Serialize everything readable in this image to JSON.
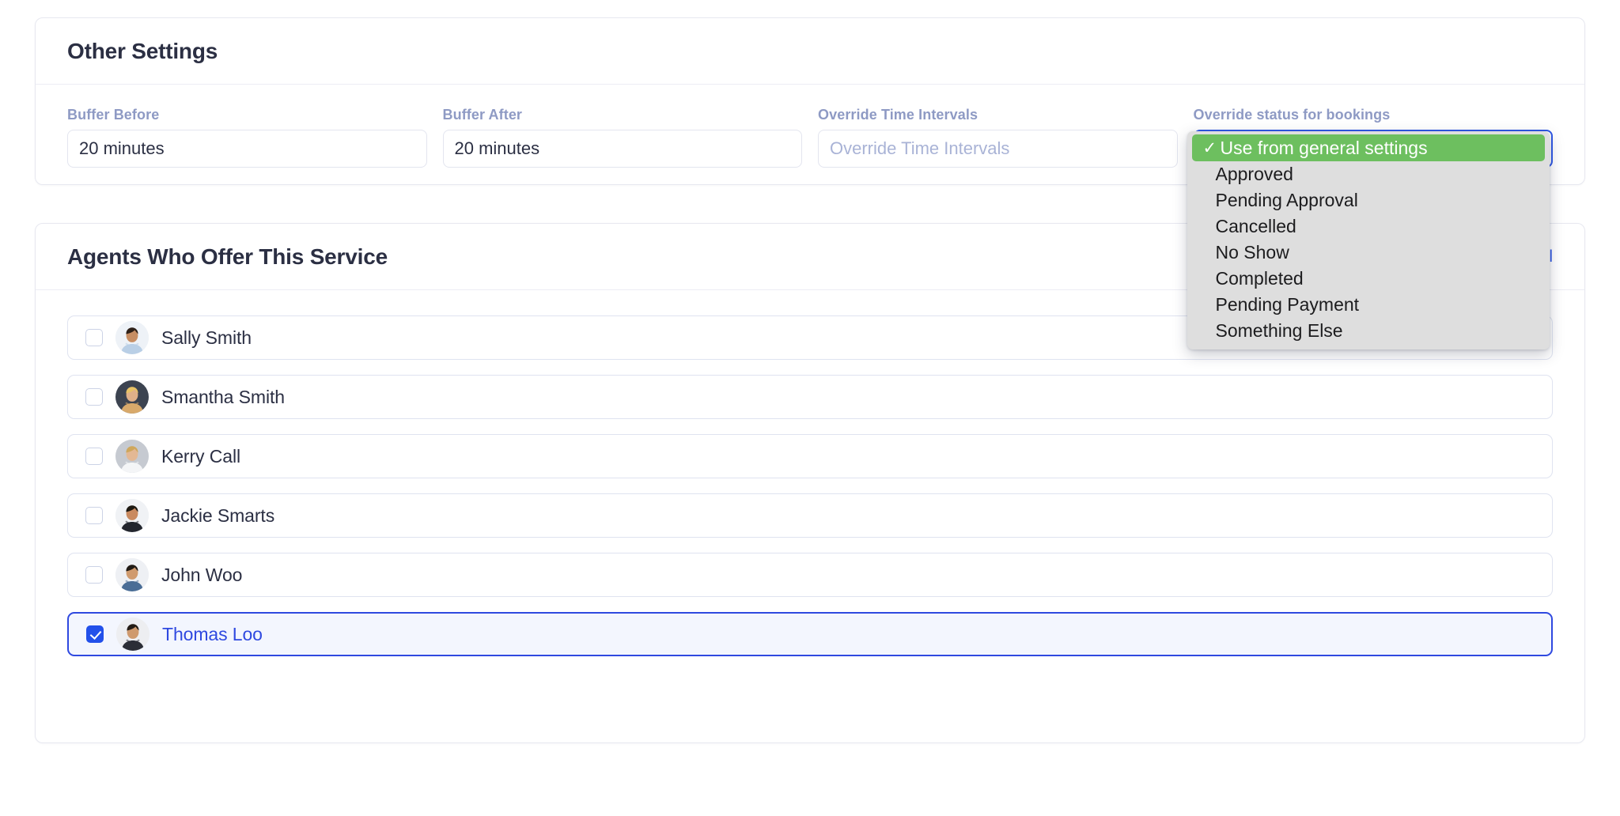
{
  "other_settings": {
    "title": "Other Settings",
    "fields": [
      {
        "label": "Buffer Before",
        "value": "20 minutes",
        "placeholder": ""
      },
      {
        "label": "Buffer After",
        "value": "20 minutes",
        "placeholder": ""
      },
      {
        "label": "Override Time Intervals",
        "value": "",
        "placeholder": "Override Time Intervals"
      }
    ],
    "status_select": {
      "label": "Override status for bookings",
      "selected": "Use from general settings",
      "check_glyph": "✓",
      "chevron_glyph": "⌄",
      "options": [
        "Use from general settings",
        "Approved",
        "Pending Approval",
        "Cancelled",
        "No Show",
        "Completed",
        "Pending Payment",
        "Something Else"
      ]
    }
  },
  "agents_section": {
    "title": "Agents Who Offer This Service",
    "select_all_label": "Select All",
    "agents": [
      {
        "name": "Sally Smith",
        "checked": false,
        "avatar": "woman-dark-hair-blue-shirt"
      },
      {
        "name": "Smantha Smith",
        "checked": false,
        "avatar": "woman-blonde-laptop"
      },
      {
        "name": "Kerry Call",
        "checked": false,
        "avatar": "woman-blonde-white-blouse"
      },
      {
        "name": "Jackie Smarts",
        "checked": false,
        "avatar": "man-suit-smiling"
      },
      {
        "name": "John Woo",
        "checked": false,
        "avatar": "man-denim-arms-crossed"
      },
      {
        "name": "Thomas Loo",
        "checked": true,
        "avatar": "man-beard-blazer"
      }
    ]
  },
  "colors": {
    "accent_blue": "#2f49e0",
    "selected_green": "#6dbf5f",
    "label_gray": "#8e9ac4",
    "text_dark": "#2b2f43",
    "menu_gray": "#dedede"
  }
}
